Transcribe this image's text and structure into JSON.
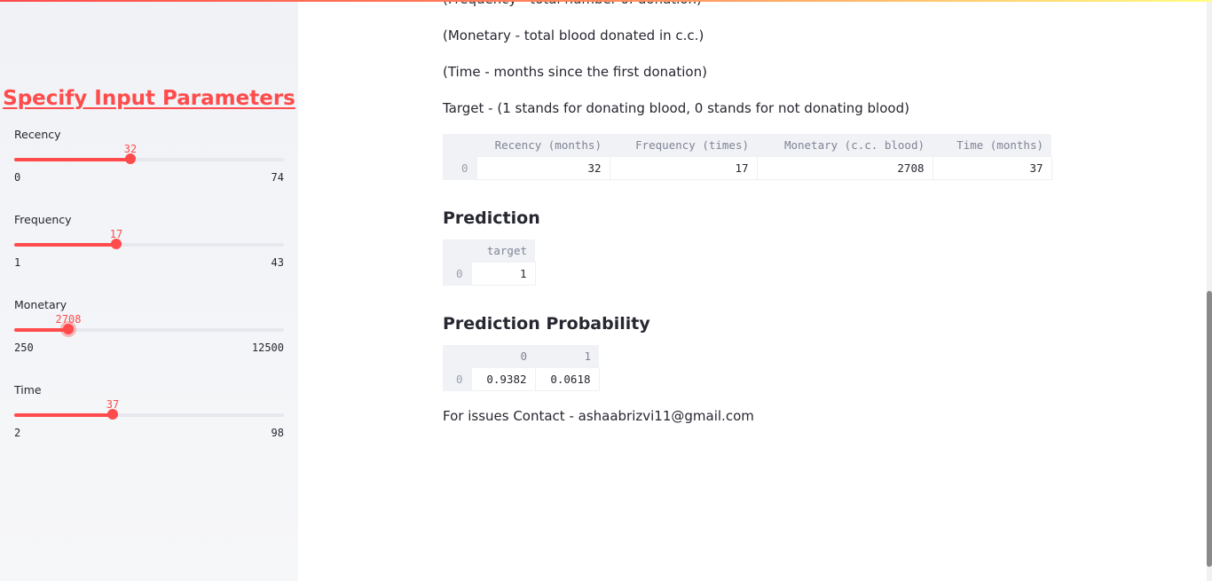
{
  "sidebar": {
    "title": "Specify Input Parameters",
    "sliders": [
      {
        "label": "Recency",
        "value": "32",
        "min": "0",
        "max": "74",
        "fraction": 0.432
      },
      {
        "label": "Frequency",
        "value": "17",
        "min": "1",
        "max": "43",
        "fraction": 0.381
      },
      {
        "label": "Monetary",
        "value": "2708",
        "min": "250",
        "max": "12500",
        "fraction": 0.201
      },
      {
        "label": "Time",
        "value": "37",
        "min": "2",
        "max": "98",
        "fraction": 0.365
      }
    ]
  },
  "main": {
    "partial_line": "(Frequency - total number of donation)",
    "monetary_line": "(Monetary - total blood donated in c.c.)",
    "time_line": "(Time - months since the first donation)",
    "target_line": "Target - (1 stands for donating blood, 0 stands for not donating blood)",
    "input_table": {
      "headers": [
        "",
        "Recency (months)",
        "Frequency (times)",
        "Monetary (c.c. blood)",
        "Time (months)"
      ],
      "rows": [
        [
          "0",
          "32",
          "17",
          "2708",
          "37"
        ]
      ]
    },
    "prediction_heading": "Prediction",
    "prediction_table": {
      "headers": [
        "",
        "target"
      ],
      "rows": [
        [
          "0",
          "1"
        ]
      ]
    },
    "probability_heading": "Prediction Probability",
    "probability_table": {
      "headers": [
        "",
        "0",
        "1"
      ],
      "rows": [
        [
          "0",
          "0.9382",
          "0.0618"
        ]
      ]
    },
    "contact_line": "For issues Contact - ashaabrizvi11@gmail.com"
  },
  "colors": {
    "accent": "#ff4b4b",
    "sidebar_bg": "#f0f2f6",
    "text": "#262730"
  }
}
